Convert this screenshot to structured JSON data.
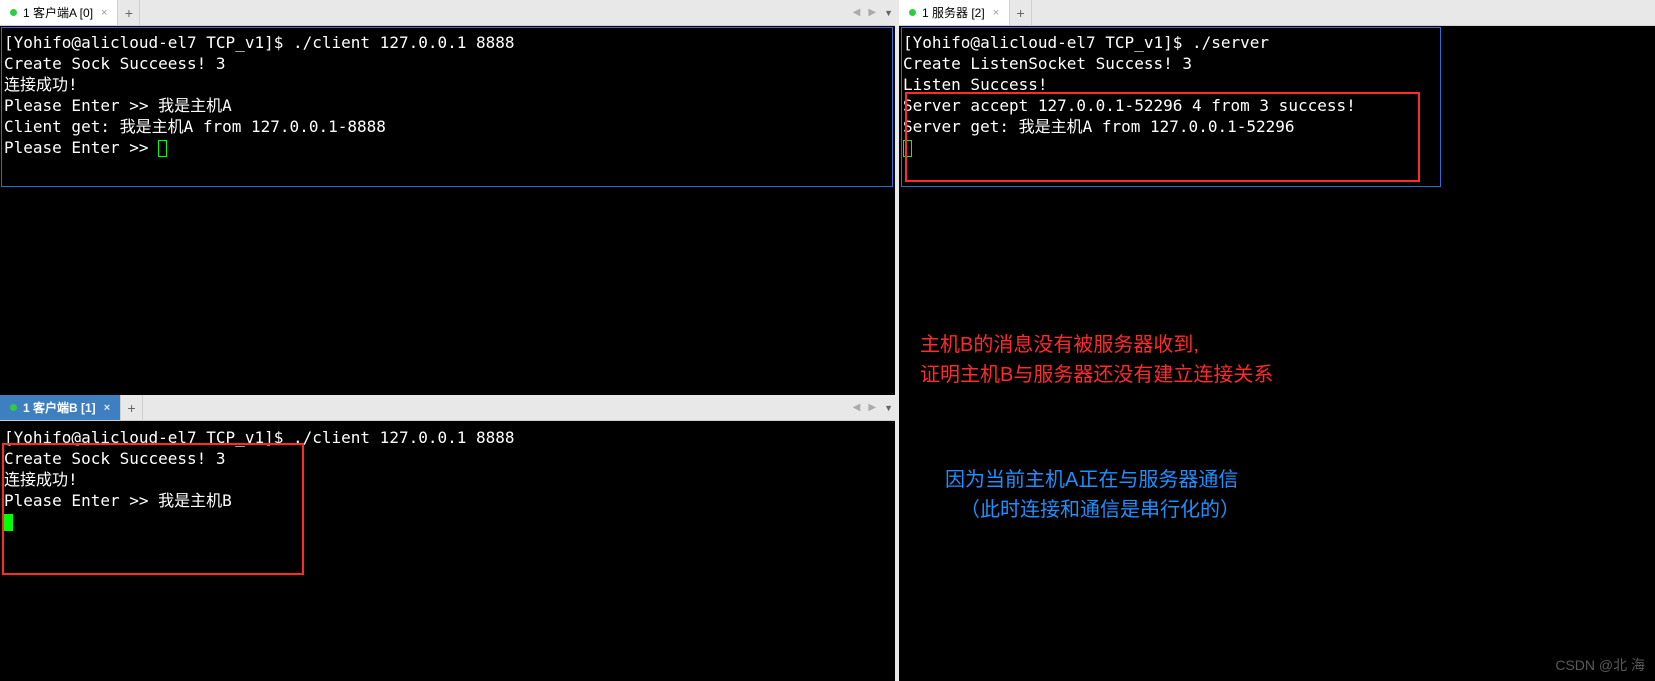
{
  "paneA": {
    "tab": {
      "label": "1 客户端A [0]"
    },
    "lines": {
      "l1_prompt": "[Yohifo@alicloud-el7 TCP_v1]$ ",
      "l1_cmd": "./client 127.0.0.1 8888",
      "l2": "Create Sock Succeess! 3",
      "l3": "连接成功!",
      "l4": "Please Enter >> 我是主机A",
      "l5": "Client get: 我是主机A from 127.0.0.1-8888",
      "l6": "Please Enter >> "
    }
  },
  "paneB": {
    "tab": {
      "label": "1 客户端B [1]"
    },
    "lines": {
      "l1_prompt": "[Yohifo@alicloud-el7 TCP_v1]$ ",
      "l1_cmd": "./client 127.0.0.1 8888",
      "l2": "Create Sock Succeess! 3",
      "l3": "连接成功!",
      "l4": "Please Enter >> 我是主机B"
    }
  },
  "paneS": {
    "tab": {
      "label": "1 服务器 [2]"
    },
    "lines": {
      "l1_prompt": "[Yohifo@alicloud-el7 TCP_v1]$ ",
      "l1_cmd": "./server",
      "l2": "Create ListenSocket Success! 3",
      "l3": "Listen Success!",
      "l4": "Server accept 127.0.0.1-52296 4 from 3 success!",
      "l5": "Server get: 我是主机A from 127.0.0.1-52296"
    }
  },
  "annotations": {
    "red1": "主机B的消息没有被服务器收到,",
    "red2": "证明主机B与服务器还没有建立连接关系",
    "blue1": "因为当前主机A正在与服务器通信",
    "blue2": "（此时连接和通信是串行化的）"
  },
  "watermark": "CSDN @北 海",
  "addLabel": "+"
}
